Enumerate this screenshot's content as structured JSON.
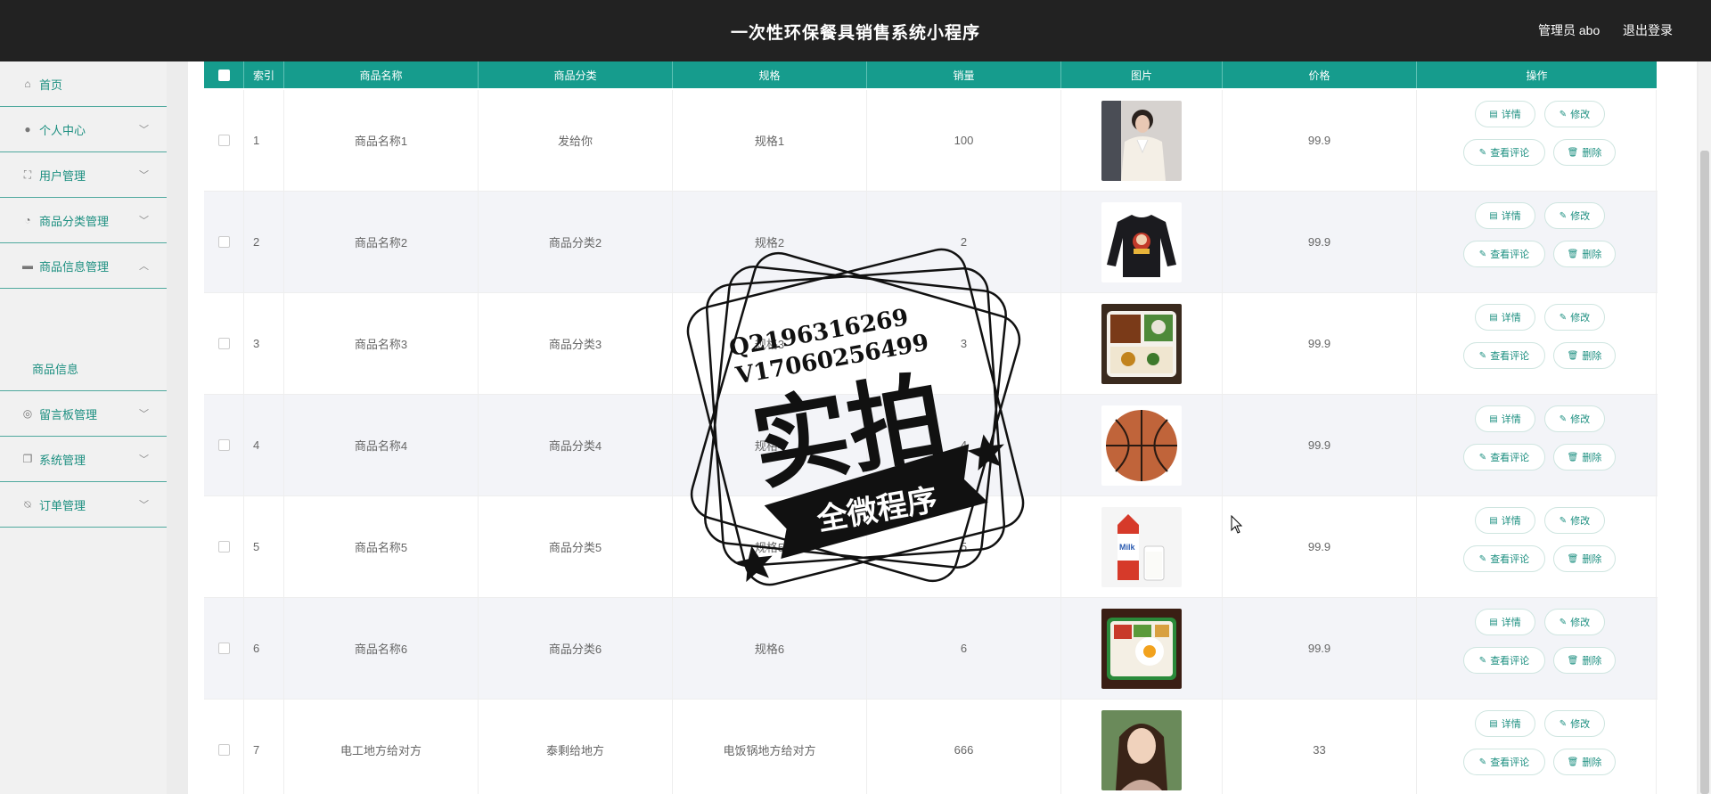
{
  "header": {
    "title": "一次性环保餐具销售系统小程序",
    "user": "管理员 abo",
    "logout": "退出登录"
  },
  "sidebar": {
    "items": [
      {
        "label": "首页",
        "icon": "home-icon"
      },
      {
        "label": "个人中心",
        "icon": "person-icon"
      },
      {
        "label": "用户管理",
        "icon": "frame-icon"
      },
      {
        "label": "商品分类管理",
        "icon": "clock-icon"
      },
      {
        "label": "商品信息管理",
        "icon": "monitor-icon"
      },
      {
        "label": "留言板管理",
        "icon": "compass-icon"
      },
      {
        "label": "系统管理",
        "icon": "copy-icon"
      },
      {
        "label": "订单管理",
        "icon": "bell-off-icon"
      }
    ],
    "submenu": {
      "label": "商品信息"
    }
  },
  "table": {
    "headers": [
      "索引",
      "商品名称",
      "商品分类",
      "规格",
      "销量",
      "图片",
      "价格",
      "操作"
    ],
    "rows": [
      {
        "index": "1",
        "name": "商品名称1",
        "category": "发给你",
        "spec": "规格1",
        "sales": "100",
        "image": "woman-blouse",
        "price": "99.9"
      },
      {
        "index": "2",
        "name": "商品名称2",
        "category": "商品分类2",
        "spec": "规格2",
        "sales": "2",
        "image": "black-sweater",
        "price": "99.9"
      },
      {
        "index": "3",
        "name": "商品名称3",
        "category": "商品分类3",
        "spec": "规格3",
        "sales": "3",
        "image": "bento-box",
        "price": "99.9"
      },
      {
        "index": "4",
        "name": "商品名称4",
        "category": "商品分类4",
        "spec": "规格4",
        "sales": "4",
        "image": "basketball",
        "price": "99.9"
      },
      {
        "index": "5",
        "name": "商品名称5",
        "category": "商品分类5",
        "spec": "规格5",
        "sales": "5",
        "image": "milk-carton",
        "price": "99.9"
      },
      {
        "index": "6",
        "name": "商品名称6",
        "category": "商品分类6",
        "spec": "规格6",
        "sales": "6",
        "image": "rice-egg-box",
        "price": "99.9"
      },
      {
        "index": "7",
        "name": "电工地方给对方",
        "category": "泰剩给地方",
        "spec": "电饭锅地方给对方",
        "sales": "666",
        "image": "woman-portrait",
        "price": "33"
      }
    ],
    "actions": {
      "detail": "详情",
      "edit": "修改",
      "comments": "查看评论",
      "delete": "删除"
    }
  },
  "watermark": {
    "line1": "Q2196316269",
    "line2": "V17060256499",
    "big": "实拍",
    "banner": "全微程序"
  },
  "colors": {
    "accent": "#169c8d",
    "header": "#222222",
    "sidebar": "#f1f1f1"
  }
}
